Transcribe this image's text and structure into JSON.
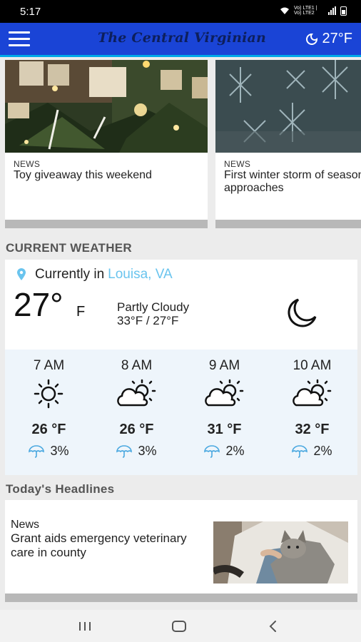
{
  "status_bar": {
    "time": "5:17",
    "network_label": "Vo) LTE1 | Vo) LTE2"
  },
  "header": {
    "title": "The Central Virginian",
    "temperature": "27°F",
    "icon": "moon-icon"
  },
  "top_stories": [
    {
      "category": "NEWS",
      "headline": "Toy giveaway this weekend"
    },
    {
      "category": "NEWS",
      "headline": "First winter storm of season approaches"
    }
  ],
  "weather": {
    "section_title": "CURRENT WEATHER",
    "location_prefix": "Currently in",
    "location": "Louisa, VA",
    "temperature": "27°",
    "unit": "F",
    "condition": "Partly Cloudy",
    "high_low": "33°F / 27°F",
    "condition_icon": "moon-icon",
    "hourly": [
      {
        "time": "7 AM",
        "icon": "sun-icon",
        "temp": "26 °F",
        "precip": "3%"
      },
      {
        "time": "8 AM",
        "icon": "partly-cloudy-icon",
        "temp": "26 °F",
        "precip": "3%"
      },
      {
        "time": "9 AM",
        "icon": "partly-cloudy-icon",
        "temp": "31 °F",
        "precip": "2%"
      },
      {
        "time": "10 AM",
        "icon": "partly-cloudy-icon",
        "temp": "32 °F",
        "precip": "2%"
      }
    ]
  },
  "headlines": {
    "section_title": "Today's Headlines",
    "items": [
      {
        "category": "News",
        "headline": "Grant aids emergency veterinary care in county"
      }
    ]
  },
  "colors": {
    "app_bar": "#1a44d6",
    "app_bar_accent": "#00a8e8",
    "link": "#6ac4ee",
    "hourly_bg": "#eef5fb"
  }
}
